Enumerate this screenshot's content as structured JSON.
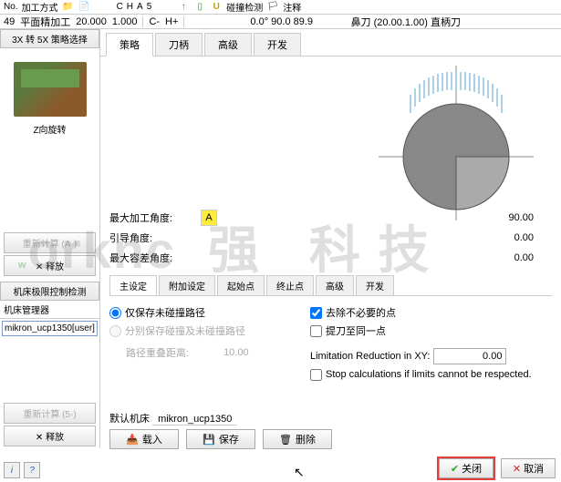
{
  "toolbar": {
    "no_label": "No.",
    "mode_label": "加工方式",
    "letters": [
      "C",
      "H",
      "A",
      "5"
    ],
    "collision_label": "碰撞检测",
    "comment_label": "注释"
  },
  "info": {
    "num": "49",
    "type": "平面精加工",
    "v1": "20.000",
    "v2": "1.000",
    "c": "C-",
    "h": "H+",
    "angles": "0.0° 90.0 89.9",
    "tool": "鼻刀 (20.00.1.00) 直柄刀"
  },
  "left": {
    "strategy_header": "3X 转 5X 策略选择",
    "preview_label": "Z向旋转",
    "recalc_a": "重新计算 (A-)",
    "release": "✕ 释放",
    "limit_header": "机床极限控制检测",
    "machine_mgr": "机床管理器",
    "machine_val": "mikron_ucp1350[user]",
    "recalc5": "重新计算 (5-)",
    "release2": "✕ 释放"
  },
  "tabs": [
    "策略",
    "刀柄",
    "高级",
    "开发"
  ],
  "fields": {
    "max_angle_label": "最大加工角度:",
    "max_angle_marker": "A",
    "max_angle_val": "90.00",
    "lead_label": "引导角度:",
    "lead_val": "0.00",
    "tol_label": "最大容差角度:",
    "tol_val": "0.00"
  },
  "subtabs": [
    "主设定",
    "附加设定",
    "起始点",
    "终止点",
    "高级",
    "开发"
  ],
  "opts": {
    "radio1": "仅保存未碰撞路径",
    "radio2": "分别保存碰撞及未碰撞路径",
    "overlap_label": "路径重叠距离:",
    "overlap_val": "10.00",
    "check1": "去除不必要的点",
    "check2": "提刀至同一点",
    "lim_label": "Limitation Reduction in XY:",
    "lim_val": "0.00",
    "stop_label": "Stop calculations if limits cannot be respected."
  },
  "machine": {
    "default_label": "默认机床",
    "default_val": "mikron_ucp1350",
    "load": "载入",
    "save": "保存",
    "delete": "删除"
  },
  "footer": {
    "close": "关闭",
    "cancel": "取消"
  }
}
